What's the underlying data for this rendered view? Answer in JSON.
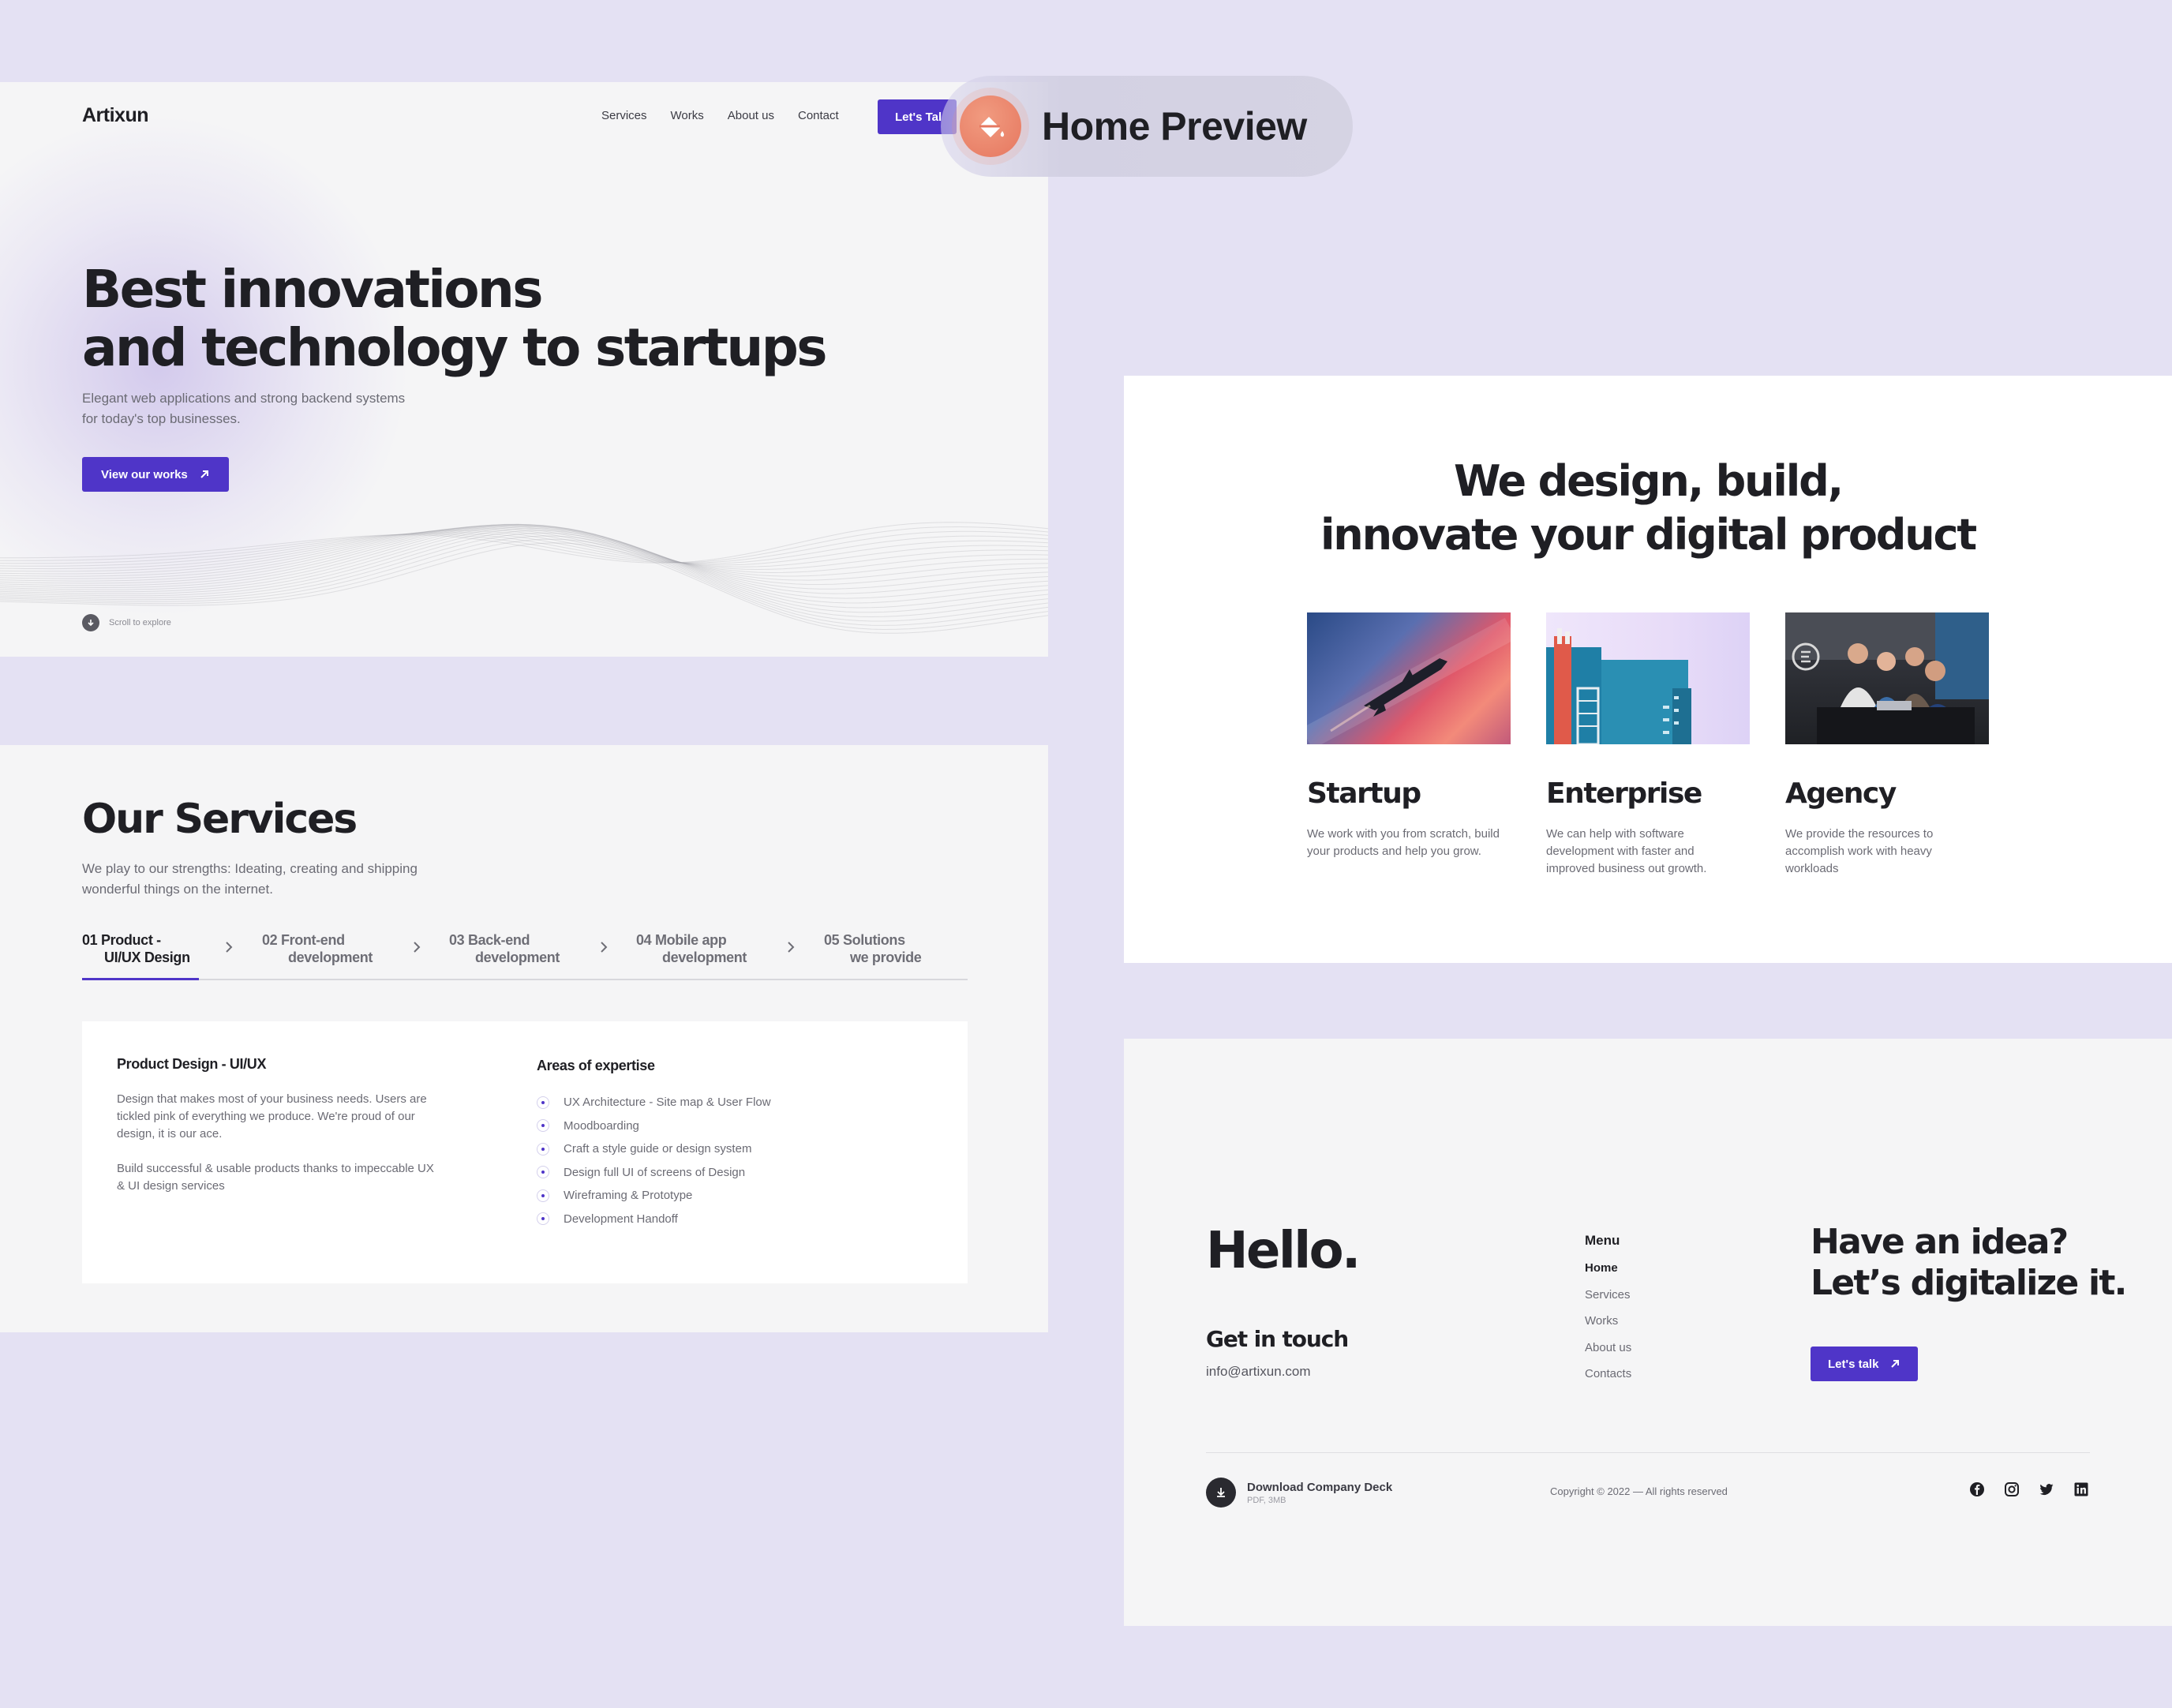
{
  "preview_label": "Home Preview",
  "hero": {
    "logo": "Artixun",
    "nav": [
      "Services",
      "Works",
      "About us",
      "Contact"
    ],
    "talk_button": "Let's Tal",
    "title_line1": "Best innovations",
    "title_line2": "and technology to startups",
    "subtitle_line1": "Elegant web applications and strong backend systems",
    "subtitle_line2": "for today's top businesses.",
    "cta": "View our works",
    "scroll": "Scroll to explore"
  },
  "services": {
    "title": "Our Services",
    "subtitle_line1": "We play to our strengths: Ideating, creating and shipping",
    "subtitle_line2": "wonderful things on the internet.",
    "tabs": [
      {
        "num": "01",
        "line1": "Product -",
        "line2": "UI/UX Design"
      },
      {
        "num": "02",
        "line1": "Front-end",
        "line2": "development"
      },
      {
        "num": "03",
        "line1": "Back-end",
        "line2": "development"
      },
      {
        "num": "04",
        "line1": "Mobile app",
        "line2": "development"
      },
      {
        "num": "05",
        "line1": "Solutions",
        "line2": "we provide"
      }
    ],
    "card": {
      "heading": "Product Design - UI/UX",
      "p1": "Design that makes most of your business needs. Users are tickled pink of everything we produce. We're proud of our design, it is our ace.",
      "p2": "Build successful & usable products thanks to impeccable UX & UI design services",
      "expertise_heading": "Areas of expertise",
      "expertise": [
        "UX Architecture - Site map & User Flow",
        "Moodboarding",
        "Craft a style guide or design system",
        "Design full UI of screens of Design",
        "Wireframing &  Prototype",
        "Development Handoff"
      ]
    }
  },
  "design": {
    "title_line1": "We design, build,",
    "title_line2": "innovate your digital product",
    "columns": [
      {
        "title": "Startup",
        "text": "We work with you from scratch, build your products and help you grow."
      },
      {
        "title": "Enterprise",
        "text": "We can help with software development with faster and improved business out growth."
      },
      {
        "title": "Agency",
        "text": "We provide the resources to accomplish work with heavy workloads"
      }
    ]
  },
  "footer": {
    "hello": "Hello.",
    "get_in_touch": "Get in touch",
    "email": "info@artixun.com",
    "menu_heading": "Menu",
    "menu": [
      "Home",
      "Services",
      "Works",
      "About us",
      "Contacts"
    ],
    "idea_line1": "Have an idea?",
    "idea_line2": "Let’s digitalize it.",
    "talk_button": "Let's talk",
    "deck_title": "Download Company Deck",
    "deck_meta": "PDF, 3MB",
    "copyright": "Copyright © 2022 — All rights reserved",
    "social": [
      "facebook-icon",
      "instagram-icon",
      "twitter-icon",
      "linkedin-icon"
    ]
  },
  "colors": {
    "background": "#e4e1f3",
    "accent": "#4f35c8",
    "badge": "#e6775f"
  }
}
